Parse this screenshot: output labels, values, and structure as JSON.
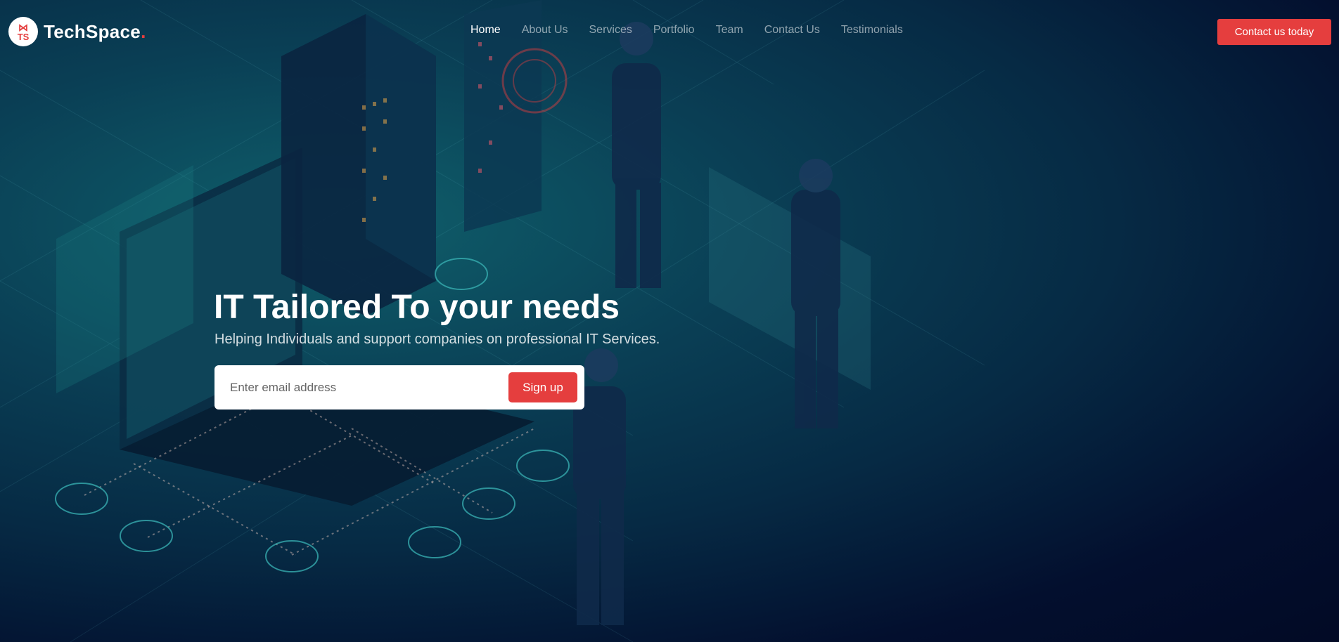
{
  "brand": {
    "badge_mark": "⋈",
    "badge_text": "TS",
    "name": "TechSpace",
    "dot": "."
  },
  "nav": {
    "items": [
      {
        "label": "Home"
      },
      {
        "label": "About Us"
      },
      {
        "label": "Services"
      },
      {
        "label": "Portfolio"
      },
      {
        "label": "Team"
      },
      {
        "label": "Contact Us"
      },
      {
        "label": "Testimonials"
      }
    ],
    "active_index": 0
  },
  "cta": {
    "label": "Contact us today"
  },
  "hero": {
    "title": "IT Tailored To your needs",
    "subtitle": "Helping Individuals and support companies on professional IT Services.",
    "email_placeholder": "Enter email address",
    "signup_label": "Sign up"
  },
  "colors": {
    "accent": "#e53e3e",
    "bg_dark": "#020a25",
    "bg_teal": "#0f5f6b"
  }
}
